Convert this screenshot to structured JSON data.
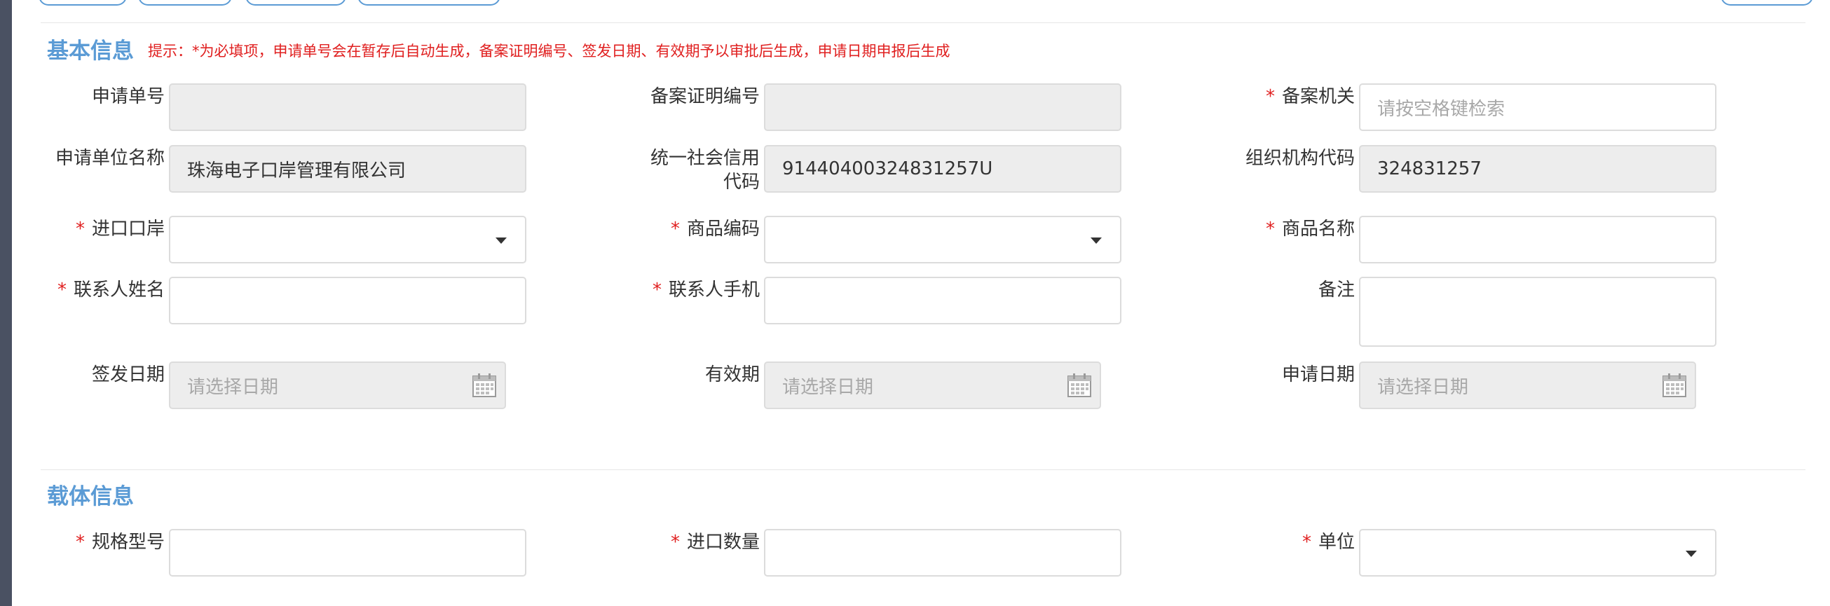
{
  "section_basic": {
    "title": "基本信息",
    "hint": "提示：*为必填项，申请单号会在暂存后自动生成，备案证明编号、签发日期、有效期予以审批后生成，申请日期申报后生成"
  },
  "fields": {
    "apply_no": {
      "label": "申请单号",
      "value": ""
    },
    "record_cert_no": {
      "label": "备案证明编号",
      "value": ""
    },
    "record_org": {
      "label": "备案机关",
      "placeholder": "请按空格键检索"
    },
    "applicant_name": {
      "label": "申请单位名称",
      "value": "珠海电子口岸管理有限公司"
    },
    "credit_code": {
      "label": "统一社会信用代码",
      "value": "91440400324831257U"
    },
    "org_code": {
      "label": "组织机构代码",
      "value": "324831257"
    },
    "import_port": {
      "label": "进口口岸",
      "value": ""
    },
    "goods_code": {
      "label": "商品编码",
      "value": ""
    },
    "goods_name": {
      "label": "商品名称",
      "value": ""
    },
    "contact_name": {
      "label": "联系人姓名",
      "value": ""
    },
    "contact_mobile": {
      "label": "联系人手机",
      "value": ""
    },
    "remark": {
      "label": "备注",
      "value": ""
    },
    "issue_date": {
      "label": "签发日期",
      "placeholder": "请选择日期"
    },
    "valid_date": {
      "label": "有效期",
      "placeholder": "请选择日期"
    },
    "apply_date": {
      "label": "申请日期",
      "placeholder": "请选择日期"
    }
  },
  "section_carrier": {
    "title": "载体信息"
  },
  "carrier_fields": {
    "spec_model": {
      "label": "规格型号",
      "value": ""
    },
    "import_qty": {
      "label": "进口数量",
      "value": ""
    },
    "unit": {
      "label": "单位",
      "value": ""
    }
  },
  "required_mark": "*",
  "colors": {
    "accent": "#5b9bd5",
    "required": "#e02020",
    "readonly_bg": "#ededed",
    "left_bar": "#4a5162"
  }
}
